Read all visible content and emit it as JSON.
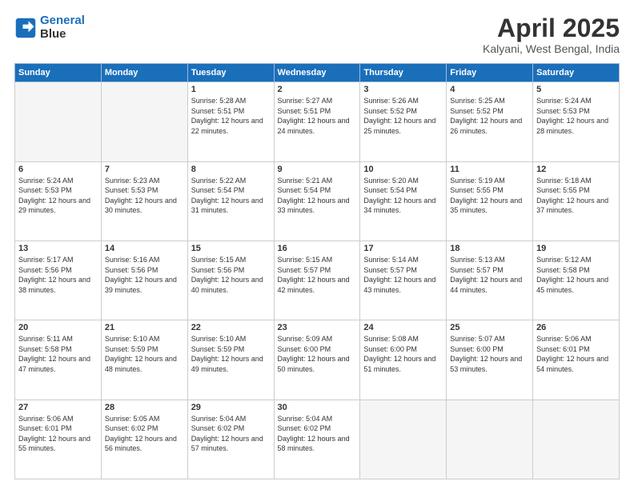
{
  "header": {
    "logo_line1": "General",
    "logo_line2": "Blue",
    "title": "April 2025",
    "subtitle": "Kalyani, West Bengal, India"
  },
  "weekdays": [
    "Sunday",
    "Monday",
    "Tuesday",
    "Wednesday",
    "Thursday",
    "Friday",
    "Saturday"
  ],
  "weeks": [
    [
      {
        "day": "",
        "empty": true
      },
      {
        "day": "",
        "empty": true
      },
      {
        "day": "1",
        "sunrise": "5:28 AM",
        "sunset": "5:51 PM",
        "daylight": "12 hours and 22 minutes."
      },
      {
        "day": "2",
        "sunrise": "5:27 AM",
        "sunset": "5:51 PM",
        "daylight": "12 hours and 24 minutes."
      },
      {
        "day": "3",
        "sunrise": "5:26 AM",
        "sunset": "5:52 PM",
        "daylight": "12 hours and 25 minutes."
      },
      {
        "day": "4",
        "sunrise": "5:25 AM",
        "sunset": "5:52 PM",
        "daylight": "12 hours and 26 minutes."
      },
      {
        "day": "5",
        "sunrise": "5:24 AM",
        "sunset": "5:53 PM",
        "daylight": "12 hours and 28 minutes."
      }
    ],
    [
      {
        "day": "6",
        "sunrise": "5:24 AM",
        "sunset": "5:53 PM",
        "daylight": "12 hours and 29 minutes."
      },
      {
        "day": "7",
        "sunrise": "5:23 AM",
        "sunset": "5:53 PM",
        "daylight": "12 hours and 30 minutes."
      },
      {
        "day": "8",
        "sunrise": "5:22 AM",
        "sunset": "5:54 PM",
        "daylight": "12 hours and 31 minutes."
      },
      {
        "day": "9",
        "sunrise": "5:21 AM",
        "sunset": "5:54 PM",
        "daylight": "12 hours and 33 minutes."
      },
      {
        "day": "10",
        "sunrise": "5:20 AM",
        "sunset": "5:54 PM",
        "daylight": "12 hours and 34 minutes."
      },
      {
        "day": "11",
        "sunrise": "5:19 AM",
        "sunset": "5:55 PM",
        "daylight": "12 hours and 35 minutes."
      },
      {
        "day": "12",
        "sunrise": "5:18 AM",
        "sunset": "5:55 PM",
        "daylight": "12 hours and 37 minutes."
      }
    ],
    [
      {
        "day": "13",
        "sunrise": "5:17 AM",
        "sunset": "5:56 PM",
        "daylight": "12 hours and 38 minutes."
      },
      {
        "day": "14",
        "sunrise": "5:16 AM",
        "sunset": "5:56 PM",
        "daylight": "12 hours and 39 minutes."
      },
      {
        "day": "15",
        "sunrise": "5:15 AM",
        "sunset": "5:56 PM",
        "daylight": "12 hours and 40 minutes."
      },
      {
        "day": "16",
        "sunrise": "5:15 AM",
        "sunset": "5:57 PM",
        "daylight": "12 hours and 42 minutes."
      },
      {
        "day": "17",
        "sunrise": "5:14 AM",
        "sunset": "5:57 PM",
        "daylight": "12 hours and 43 minutes."
      },
      {
        "day": "18",
        "sunrise": "5:13 AM",
        "sunset": "5:57 PM",
        "daylight": "12 hours and 44 minutes."
      },
      {
        "day": "19",
        "sunrise": "5:12 AM",
        "sunset": "5:58 PM",
        "daylight": "12 hours and 45 minutes."
      }
    ],
    [
      {
        "day": "20",
        "sunrise": "5:11 AM",
        "sunset": "5:58 PM",
        "daylight": "12 hours and 47 minutes."
      },
      {
        "day": "21",
        "sunrise": "5:10 AM",
        "sunset": "5:59 PM",
        "daylight": "12 hours and 48 minutes."
      },
      {
        "day": "22",
        "sunrise": "5:10 AM",
        "sunset": "5:59 PM",
        "daylight": "12 hours and 49 minutes."
      },
      {
        "day": "23",
        "sunrise": "5:09 AM",
        "sunset": "6:00 PM",
        "daylight": "12 hours and 50 minutes."
      },
      {
        "day": "24",
        "sunrise": "5:08 AM",
        "sunset": "6:00 PM",
        "daylight": "12 hours and 51 minutes."
      },
      {
        "day": "25",
        "sunrise": "5:07 AM",
        "sunset": "6:00 PM",
        "daylight": "12 hours and 53 minutes."
      },
      {
        "day": "26",
        "sunrise": "5:06 AM",
        "sunset": "6:01 PM",
        "daylight": "12 hours and 54 minutes."
      }
    ],
    [
      {
        "day": "27",
        "sunrise": "5:06 AM",
        "sunset": "6:01 PM",
        "daylight": "12 hours and 55 minutes."
      },
      {
        "day": "28",
        "sunrise": "5:05 AM",
        "sunset": "6:02 PM",
        "daylight": "12 hours and 56 minutes."
      },
      {
        "day": "29",
        "sunrise": "5:04 AM",
        "sunset": "6:02 PM",
        "daylight": "12 hours and 57 minutes."
      },
      {
        "day": "30",
        "sunrise": "5:04 AM",
        "sunset": "6:02 PM",
        "daylight": "12 hours and 58 minutes."
      },
      {
        "day": "",
        "empty": true
      },
      {
        "day": "",
        "empty": true
      },
      {
        "day": "",
        "empty": true
      }
    ]
  ]
}
